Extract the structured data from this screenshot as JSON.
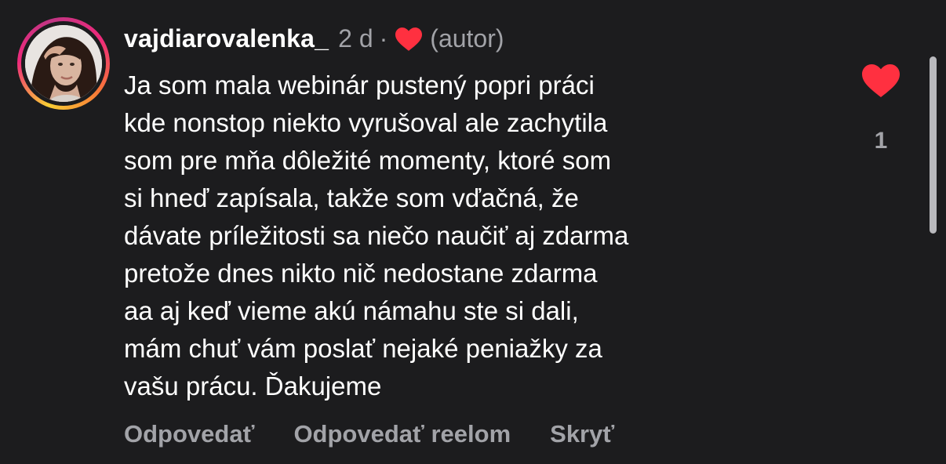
{
  "comment": {
    "username": "vajdiarovalenka_",
    "time": "2 d",
    "separator": "·",
    "author_label": "(autor)",
    "text_lines": [
      "Ja som mala webinár pustený popri práci",
      "kde nonstop niekto vyrušoval ale zachytila",
      "som pre mňa dôležité momenty, ktoré som",
      "si hneď zapísala, takže som vďačná, že",
      "dávate príležitosti sa niečo naučiť aj zdarma",
      "pretože dnes nikto nič nedostane zdarma",
      "aa aj keď vieme akú námahu ste si dali,",
      "mám chuť vám poslať nejaké peniažky za",
      "vašu prácu. Ďakujeme"
    ],
    "like_count": "1"
  },
  "actions": {
    "reply": "Odpovedať",
    "reply_reel": "Odpovedať reelom",
    "hide": "Skryť"
  },
  "colors": {
    "background": "#1c1c1e",
    "heart": "#ff3040",
    "muted_text": "#a2a3a8"
  }
}
